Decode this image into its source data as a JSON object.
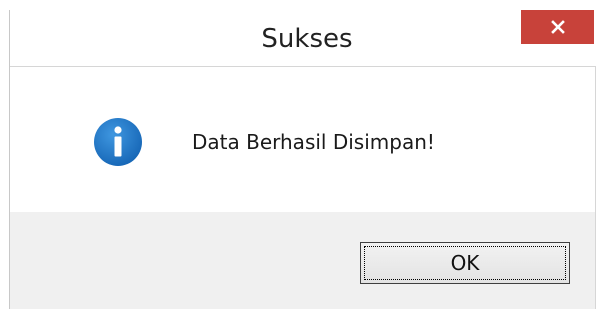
{
  "window": {
    "title": "Sukses",
    "close_icon": "close-icon",
    "close_color": "#c8423a"
  },
  "body": {
    "icon": "info-icon",
    "icon_color": "#1c78c8",
    "message": "Data Berhasil Disimpan!"
  },
  "footer": {
    "ok_label": "OK"
  }
}
